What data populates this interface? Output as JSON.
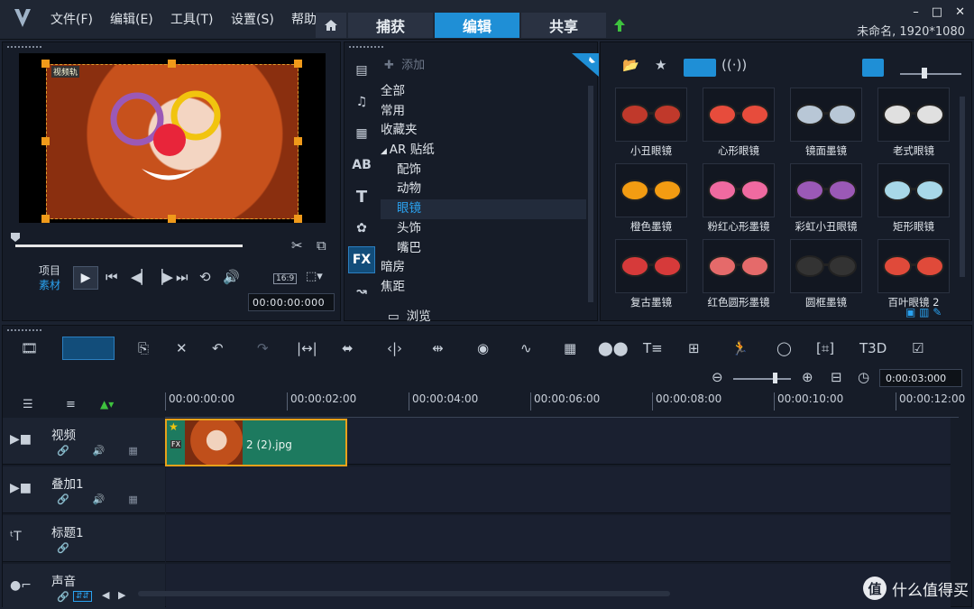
{
  "menu": [
    "文件(F)",
    "编辑(E)",
    "工具(T)",
    "设置(S)",
    "帮助"
  ],
  "topnav": {
    "home_icon": "home-icon",
    "tabs": [
      "捕获",
      "编辑",
      "共享"
    ],
    "active": "编辑"
  },
  "window": {
    "minimize": "–",
    "maximize": "□",
    "close": "✕",
    "project": "未命名, 1920*1080"
  },
  "preview": {
    "track_label": "视频轨",
    "mode_project": "项目",
    "mode_clip": "素材",
    "aspect": "16:9",
    "timecode": "00:00:00:000"
  },
  "library": {
    "add_label": "添加",
    "categories": [
      {
        "label": "全部",
        "level": 0
      },
      {
        "label": "常用",
        "level": 0
      },
      {
        "label": "收藏夹",
        "level": 0
      },
      {
        "label": "AR 贴纸",
        "level": 0,
        "expanded": true
      },
      {
        "label": "配饰",
        "level": 1
      },
      {
        "label": "动物",
        "level": 1
      },
      {
        "label": "眼镜",
        "level": 1,
        "selected": true
      },
      {
        "label": "头饰",
        "level": 1
      },
      {
        "label": "嘴巴",
        "level": 1
      },
      {
        "label": "暗房",
        "level": 0
      },
      {
        "label": "焦距",
        "level": 0
      }
    ],
    "browse_label": "浏览",
    "side_icons": [
      "media-icon",
      "audio-icon",
      "instant-project-icon",
      "transition-icon",
      "title-icon",
      "graphic-icon",
      "fx-icon",
      "path-icon"
    ],
    "fx_label": "FX"
  },
  "gallery": {
    "items": [
      {
        "caption": "小丑眼镜",
        "color": "#c0392b"
      },
      {
        "caption": "心形眼镜",
        "color": "#e74c3c"
      },
      {
        "caption": "镜面墨镜",
        "color": "#b8c7d6"
      },
      {
        "caption": "老式眼镜",
        "color": "#e0e0e0"
      },
      {
        "caption": "橙色墨镜",
        "color": "#f39c12"
      },
      {
        "caption": "粉红心形墨镜",
        "color": "#f06aa0"
      },
      {
        "caption": "彩虹小丑眼镜",
        "color": "#9b59b6"
      },
      {
        "caption": "矩形眼镜",
        "color": "#a8d8e8"
      },
      {
        "caption": "复古墨镜",
        "color": "#d63a3a"
      },
      {
        "caption": "红色圆形墨镜",
        "color": "#e56a6a"
      },
      {
        "caption": "圆框墨镜",
        "color": "#333333"
      },
      {
        "caption": "百叶眼镜 2",
        "color": "#e04a3a"
      }
    ]
  },
  "timeline": {
    "timecode": "0:00:03:000",
    "ruler": [
      "00:00:00:00",
      "00:00:02:00",
      "00:00:04:00",
      "00:00:06:00",
      "00:00:08:00",
      "00:00:10:00",
      "00:00:12:00"
    ],
    "tracks": [
      {
        "name": "视频",
        "icon": "video-track-icon"
      },
      {
        "name": "叠加1",
        "icon": "overlay-track-icon"
      },
      {
        "name": "标题1",
        "icon": "title-track-icon"
      },
      {
        "name": "声音",
        "icon": "voice-track-icon"
      }
    ],
    "clip": {
      "label": "2 (2).jpg",
      "fx": "FX"
    }
  },
  "watermark": {
    "icon_char": "值",
    "text": "什么值得买"
  }
}
